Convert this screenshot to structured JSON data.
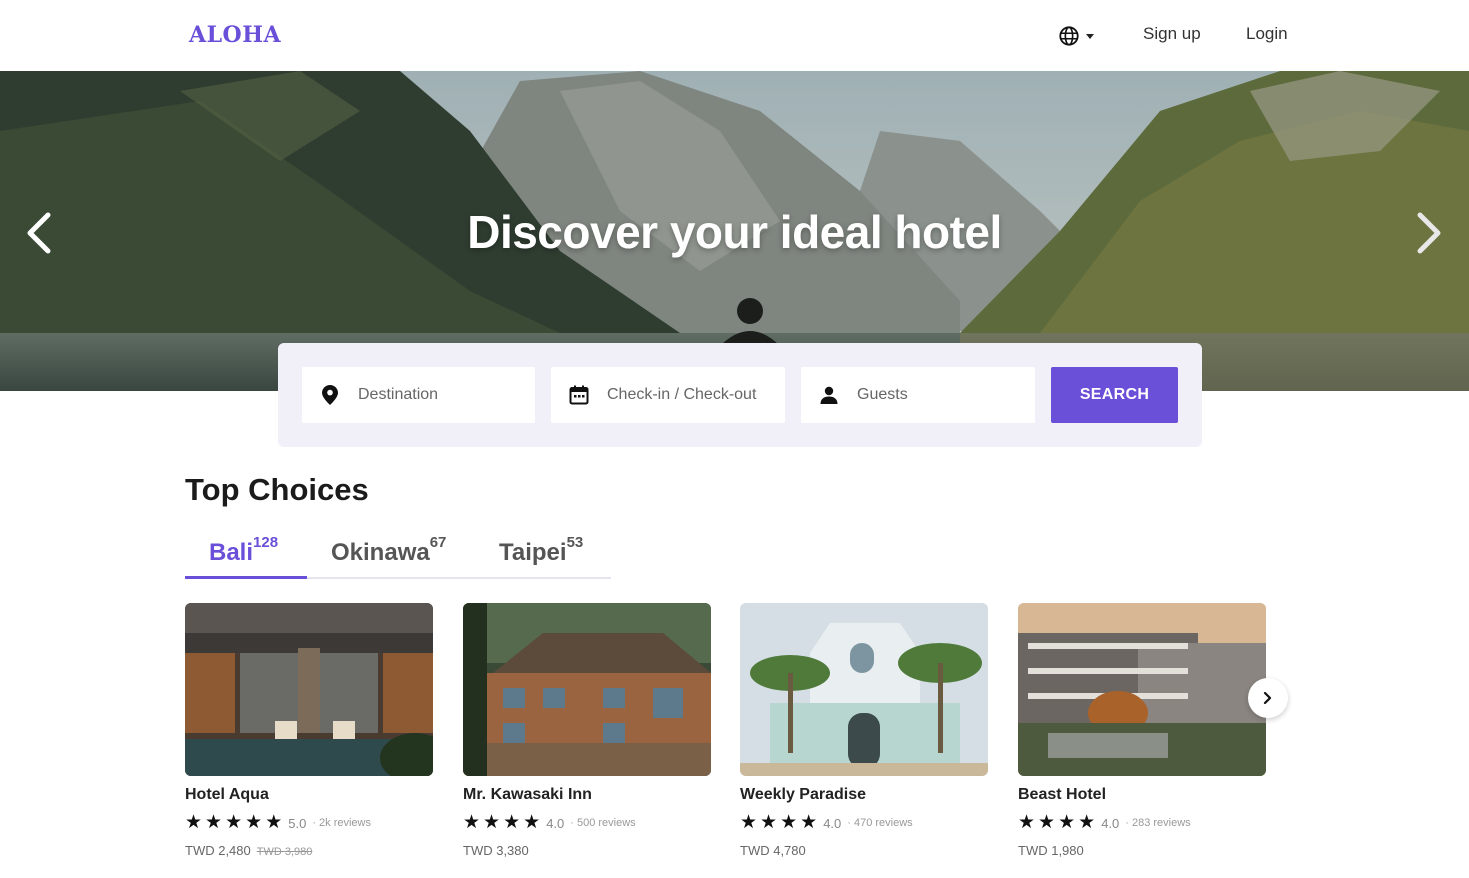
{
  "header": {
    "logo": "ALOHA",
    "language_icon": "globe-icon",
    "signup_label": "Sign up",
    "login_label": "Login"
  },
  "hero": {
    "title": "Discover your ideal hotel",
    "prev_icon": "chevron-left-icon",
    "next_icon": "chevron-right-icon"
  },
  "search": {
    "destination_placeholder": "Destination",
    "dates_placeholder": "Check-in / Check-out",
    "guests_placeholder": "Guests",
    "button_label": "SEARCH"
  },
  "top_choices": {
    "title": "Top Choices",
    "tabs": [
      {
        "label": "Bali",
        "count": "128",
        "active": true
      },
      {
        "label": "Okinawa",
        "count": "67",
        "active": false
      },
      {
        "label": "Taipei",
        "count": "53",
        "active": false
      }
    ],
    "hotels": [
      {
        "name": "Hotel Aqua",
        "stars": 5,
        "score": "5.0",
        "reviews": "· 2k reviews",
        "price": "TWD 2,480",
        "old_price": "TWD 3,980"
      },
      {
        "name": "Mr. Kawasaki Inn",
        "stars": 4,
        "score": "4.0",
        "reviews": "· 500 reviews",
        "price": "TWD 3,380",
        "old_price": ""
      },
      {
        "name": "Weekly Paradise",
        "stars": 4,
        "score": "4.0",
        "reviews": "· 470 reviews",
        "price": "TWD 4,780",
        "old_price": ""
      },
      {
        "name": "Beast Hotel",
        "stars": 4,
        "score": "4.0",
        "reviews": "· 283 reviews",
        "price": "TWD 1,980",
        "old_price": ""
      }
    ],
    "next_icon": "chevron-right-icon"
  },
  "colors": {
    "accent": "#6a4fd8",
    "panel": "#f1eff8"
  }
}
